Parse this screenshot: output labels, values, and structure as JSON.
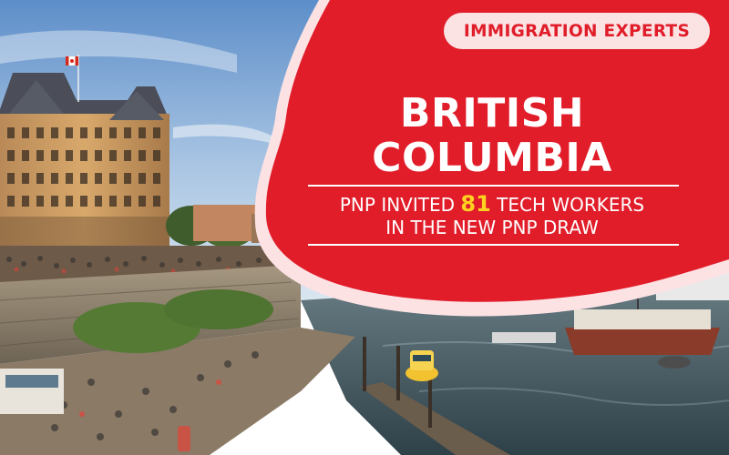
{
  "badge": {
    "label": "IMMIGRATION EXPERTS"
  },
  "headline": {
    "line1": "BRITISH",
    "line2": "COLUMBIA"
  },
  "subheadline": {
    "line1_prefix": "PNP INVITED ",
    "highlight_number": "81",
    "line1_suffix": " TECH WORKERS",
    "line2": "IN THE NEW PNP DRAW"
  },
  "colors": {
    "brand_red": "#e11d2a",
    "badge_bg": "#fbe3e3",
    "highlight_yellow": "#ffd21f",
    "panel_border": "#fde2e4"
  },
  "icons": [
    "canada-flag-icon"
  ]
}
